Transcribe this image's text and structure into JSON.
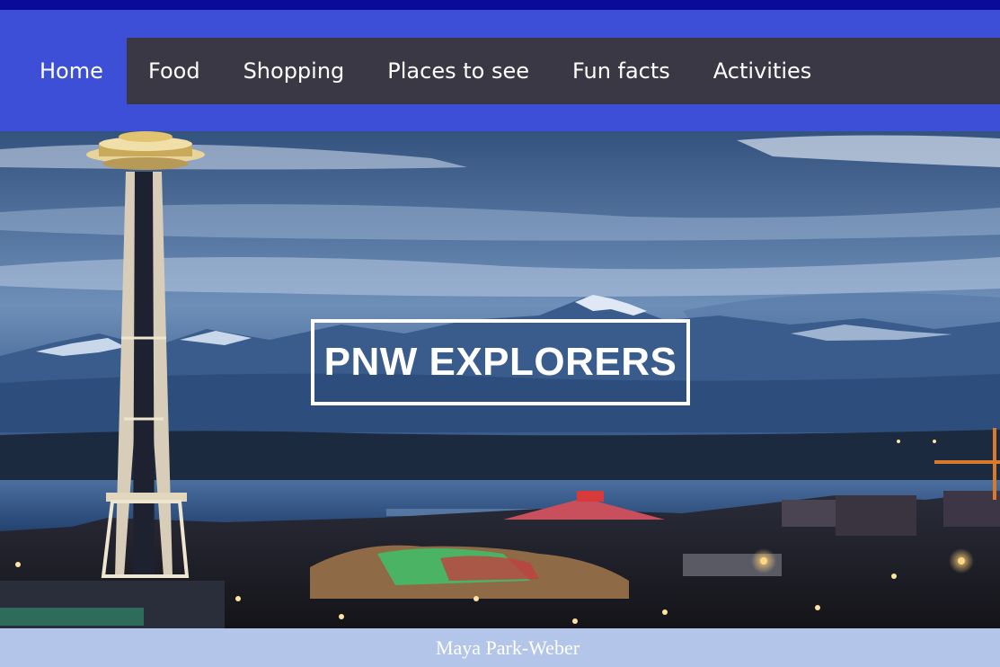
{
  "nav": {
    "items": [
      {
        "label": "Home"
      },
      {
        "label": "Food"
      },
      {
        "label": "Shopping"
      },
      {
        "label": "Places to see"
      },
      {
        "label": "Fun facts"
      },
      {
        "label": "Activities"
      }
    ]
  },
  "hero": {
    "title": "PNW EXPLORERS",
    "image_icon": "seattle-skyline-image"
  },
  "footer": {
    "author": "Maya Park-Weber"
  },
  "colors": {
    "top_strip": "#0a0b98",
    "nav_band": "#3d4fd6",
    "nav_bar": "#393844",
    "footer": "#b3c5e8",
    "text": "#ffffff"
  }
}
